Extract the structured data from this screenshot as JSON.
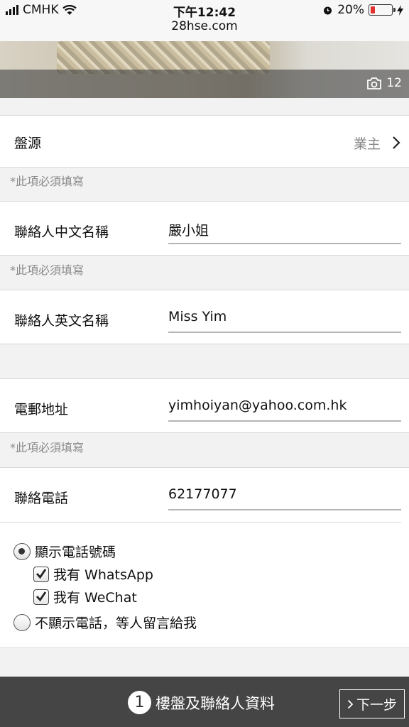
{
  "status_bar": {
    "carrier": "CMHK",
    "time": "下午12:42",
    "url": "28hse.com",
    "battery_text": "20%",
    "battery_level": 0.2
  },
  "photo": {
    "photo_count": "12",
    "icon": "camera-icon"
  },
  "source": {
    "label": "盤源",
    "value": "業主",
    "icon": "chevron-right-icon"
  },
  "required_note": "*此項必須填寫",
  "contact_cn_name": {
    "label": "聯絡人中文名稱",
    "value": "嚴小姐"
  },
  "contact_en_name": {
    "label": "聯絡人英文名稱",
    "value": "Miss Yim"
  },
  "email": {
    "label": "電郵地址",
    "value": "yimhoiyan@yahoo.com.hk"
  },
  "phone": {
    "label": "聯絡電話",
    "value": "62177077"
  },
  "phone_options": {
    "show_phone": "顯示電話號碼",
    "has_whatsapp": "我有 WhatsApp",
    "has_wechat": "我有 WeChat",
    "hide_phone": "不顯示電話，等人留言給我"
  },
  "bottom_bar": {
    "step_number": "1",
    "step_title": "樓盤及聯絡人資料",
    "next_label": "下一步"
  },
  "colors": {
    "bottom_bar": "#454545",
    "battery_low": "#e0312f",
    "field_underline": "#b5b5b5"
  }
}
